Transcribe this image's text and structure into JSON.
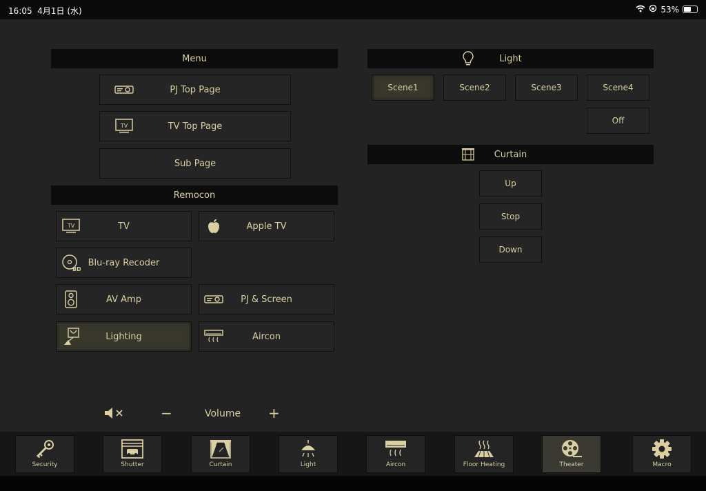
{
  "status": {
    "time": "16:05",
    "date": "4月1日 (水)",
    "battery_text": "53%",
    "battery_level": 0.53
  },
  "menu": {
    "title": "Menu",
    "items": [
      {
        "label": "PJ Top Page",
        "icon": "projector-icon"
      },
      {
        "label": "TV Top Page",
        "icon": "tv-icon"
      },
      {
        "label": "Sub Page"
      }
    ]
  },
  "remocon": {
    "title": "Remocon",
    "items": [
      {
        "label": "TV",
        "icon": "tv-icon"
      },
      {
        "label": "Apple TV",
        "icon": "apple-icon"
      },
      {
        "label": "Blu-ray Recoder",
        "icon": "bluray-disc-icon"
      },
      {
        "label": "AV Amp",
        "icon": "speaker-icon"
      },
      {
        "label": "PJ & Screen",
        "icon": "projector-icon"
      },
      {
        "label": "Lighting",
        "icon": "lamp-icon",
        "active": true
      },
      {
        "label": "Aircon",
        "icon": "aircon-icon"
      }
    ]
  },
  "light": {
    "title": "Light",
    "icon": "lightbulb-icon",
    "scenes": [
      "Scene1",
      "Scene2",
      "Scene3",
      "Scene4"
    ],
    "active_scene": "Scene1",
    "off_label": "Off"
  },
  "curtain": {
    "title": "Curtain",
    "icon": "curtain-icon",
    "up": "Up",
    "stop": "Stop",
    "down": "Down"
  },
  "volume": {
    "label": "Volume",
    "minus": "−",
    "plus": "+"
  },
  "tabs": [
    {
      "label": "Security",
      "icon": "key-icon"
    },
    {
      "label": "Shutter",
      "icon": "garage-shutter-icon"
    },
    {
      "label": "Curtain",
      "icon": "curtain-icon"
    },
    {
      "label": "Light",
      "icon": "ceiling-lamp-icon"
    },
    {
      "label": "Aircon",
      "icon": "aircon-icon"
    },
    {
      "label": "Floor Heating",
      "icon": "floor-heating-icon"
    },
    {
      "label": "Theater",
      "icon": "film-reel-icon",
      "active": true
    },
    {
      "label": "Macro",
      "icon": "gear-icon"
    }
  ],
  "colors": {
    "accent": "#d9cfa0",
    "background": "#232323",
    "header": "#0c0c0c"
  }
}
